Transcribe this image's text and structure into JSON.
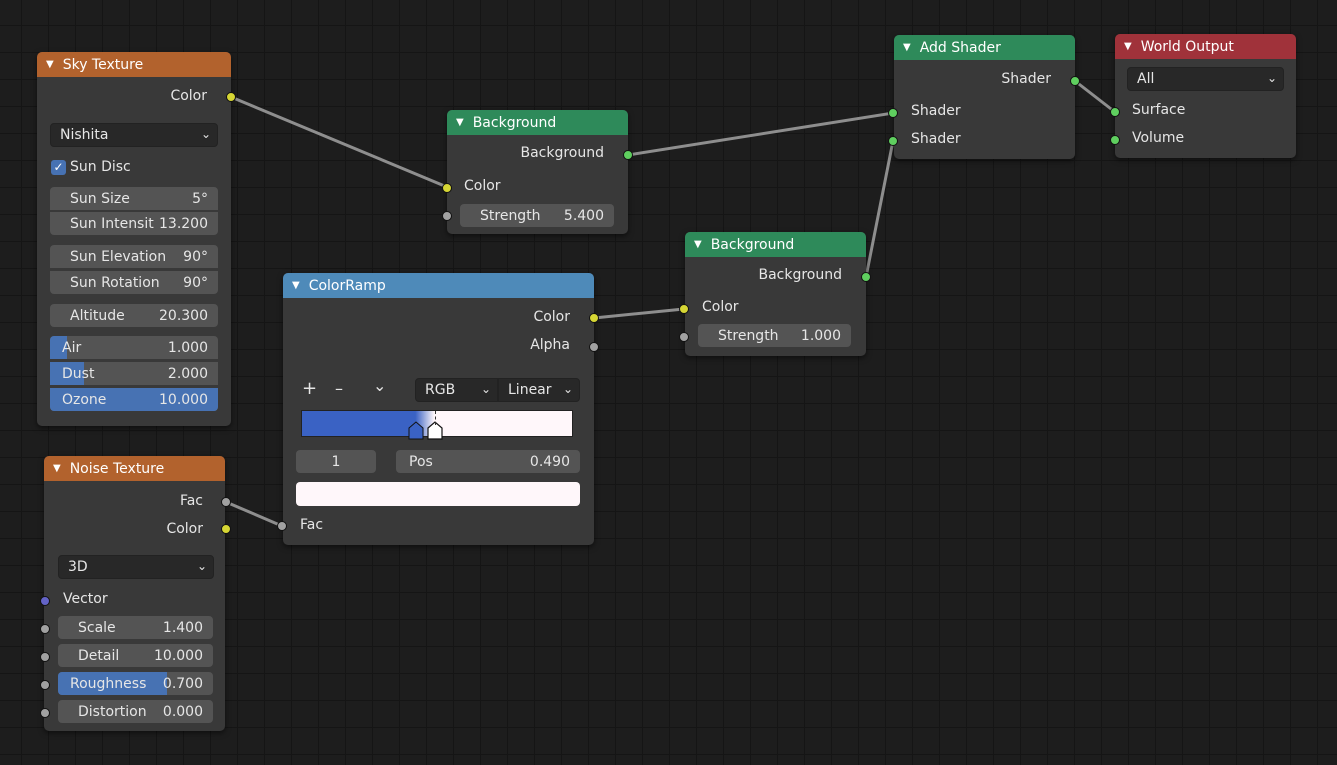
{
  "sky": {
    "title": "Sky Texture",
    "out_color": "Color",
    "type_select": "Nishita",
    "sun_disc": "Sun Disc",
    "sun_size": {
      "label": "Sun Size",
      "value": "5°"
    },
    "sun_intensity": {
      "label": "Sun Intensit",
      "value": "13.200"
    },
    "sun_elevation": {
      "label": "Sun Elevation",
      "value": "90°"
    },
    "sun_rotation": {
      "label": "Sun Rotation",
      "value": "90°"
    },
    "altitude": {
      "label": "Altitude",
      "value": "20.300"
    },
    "air": {
      "label": "Air",
      "value": "1.000",
      "fill": 0.1
    },
    "dust": {
      "label": "Dust",
      "value": "2.000",
      "fill": 0.2
    },
    "ozone": {
      "label": "Ozone",
      "value": "10.000",
      "fill": 1.0
    }
  },
  "noise": {
    "title": "Noise Texture",
    "out_fac": "Fac",
    "out_color": "Color",
    "dim_select": "3D",
    "vector": "Vector",
    "scale": {
      "label": "Scale",
      "value": "1.400"
    },
    "detail": {
      "label": "Detail",
      "value": "10.000"
    },
    "roughness": {
      "label": "Roughness",
      "value": "0.700",
      "fill": 0.7
    },
    "distortion": {
      "label": "Distortion",
      "value": "0.000"
    }
  },
  "bg1": {
    "title": "Background",
    "out": "Background",
    "in_color": "Color",
    "strength": {
      "label": "Strength",
      "value": "5.400"
    }
  },
  "bg2": {
    "title": "Background",
    "out": "Background",
    "in_color": "Color",
    "strength": {
      "label": "Strength",
      "value": "1.000"
    }
  },
  "ramp": {
    "title": "ColorRamp",
    "out_color": "Color",
    "out_alpha": "Alpha",
    "add": "+",
    "remove": "–",
    "menu": "⌄",
    "color_mode": "RGB",
    "interpolation": "Linear",
    "stop_index": "1",
    "pos_label": "Pos",
    "pos_value": "0.490",
    "in_fac": "Fac",
    "stop_colors": [
      "#3a62c4",
      "#fff7fa"
    ]
  },
  "add_shader": {
    "title": "Add Shader",
    "out": "Shader",
    "in1": "Shader",
    "in2": "Shader"
  },
  "world": {
    "title": "World Output",
    "target_select": "All",
    "surface": "Surface",
    "volume": "Volume"
  },
  "colors": {
    "socket_color": "#d6d634",
    "socket_shader": "#5fcf5f",
    "socket_float": "#a1a1a1",
    "socket_vector": "#6363c7",
    "wire": "#8c8c8c"
  }
}
